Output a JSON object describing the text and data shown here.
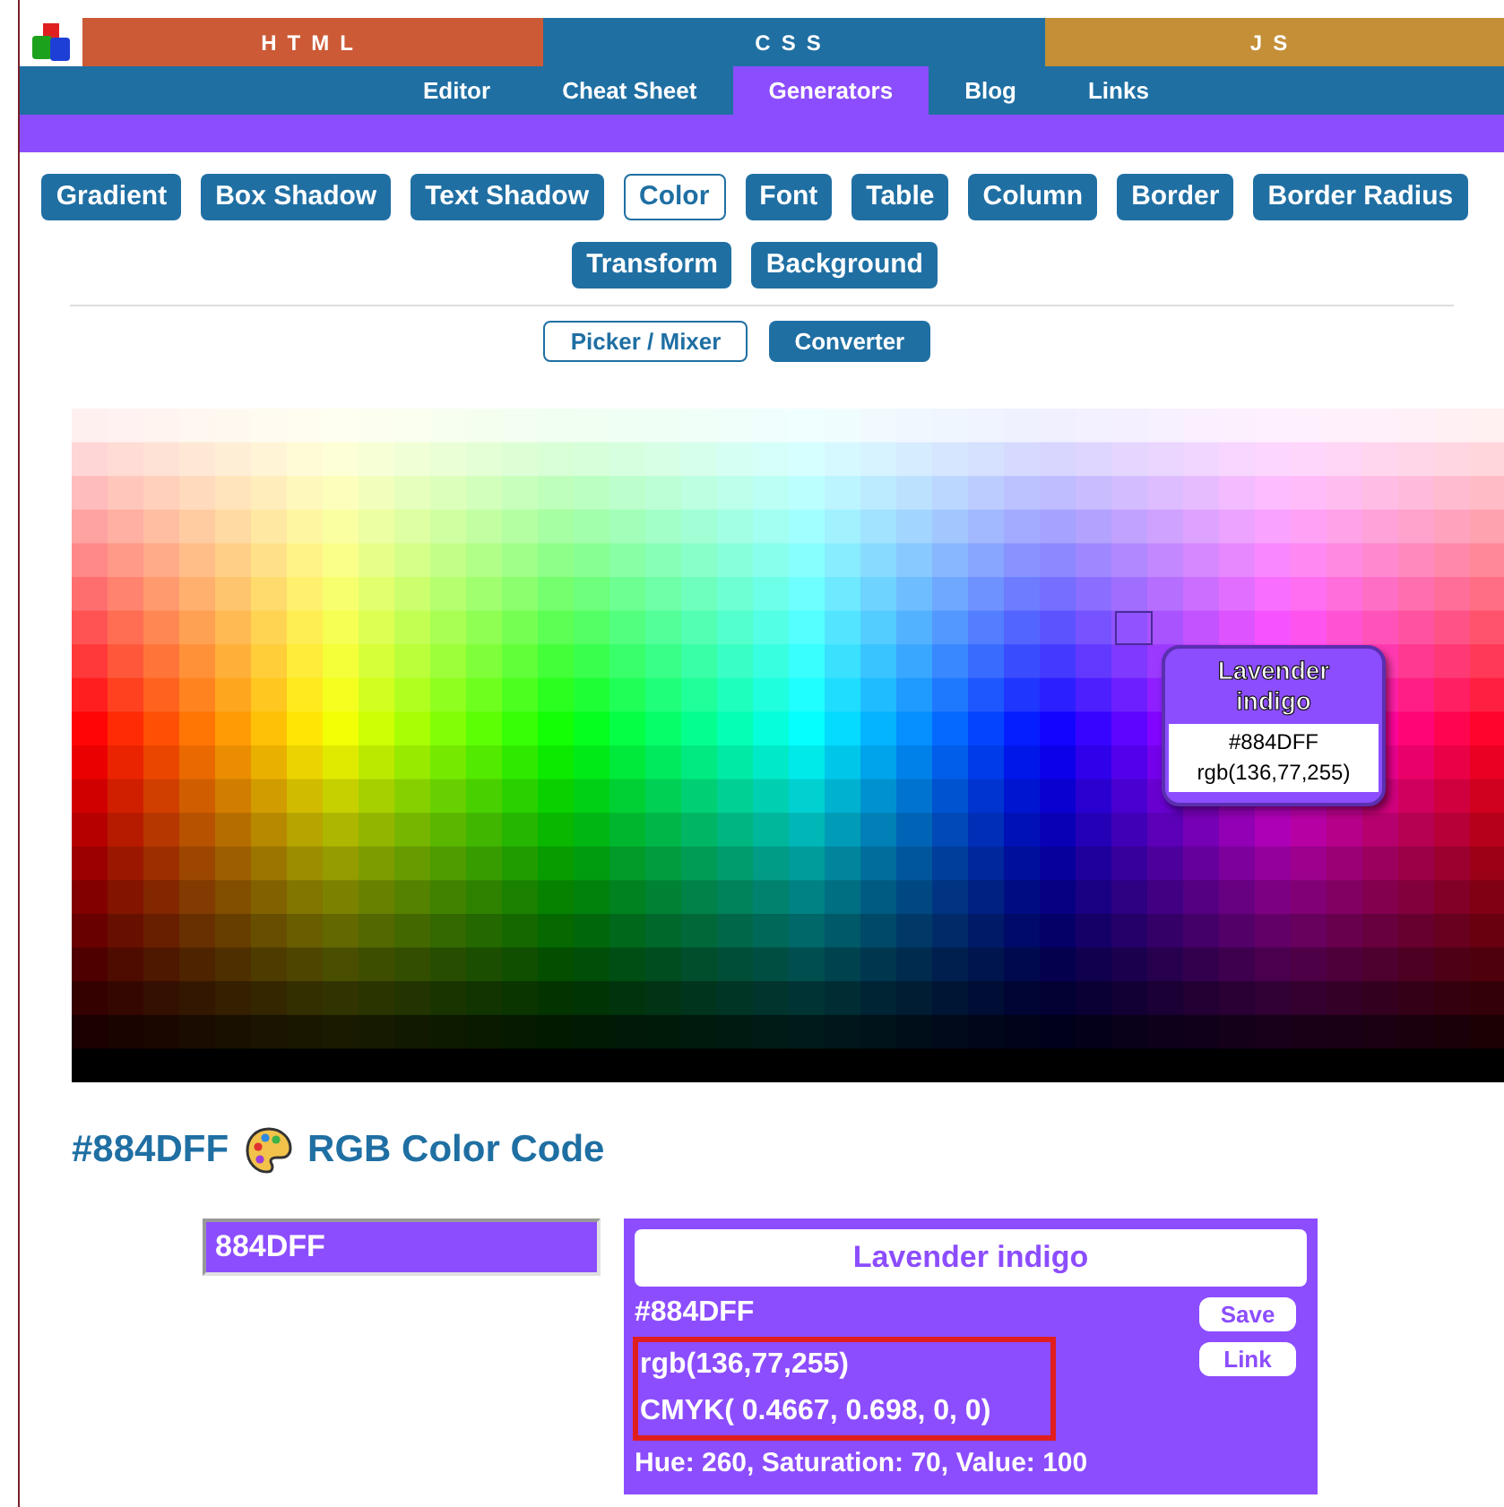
{
  "top_tabs": [
    {
      "label": "HTML",
      "color": "#cc5a36"
    },
    {
      "label": "CSS",
      "color": "#1f6fa3"
    },
    {
      "label": "JS",
      "color": "#c48f37"
    }
  ],
  "subnav": [
    {
      "label": "Editor",
      "selected": false
    },
    {
      "label": "Cheat Sheet",
      "selected": false
    },
    {
      "label": "Generators",
      "selected": true
    },
    {
      "label": "Blog",
      "selected": false
    },
    {
      "label": "Links",
      "selected": false
    }
  ],
  "generators": [
    {
      "label": "Gradient",
      "selected": false
    },
    {
      "label": "Box Shadow",
      "selected": false
    },
    {
      "label": "Text Shadow",
      "selected": false
    },
    {
      "label": "Color",
      "selected": true
    },
    {
      "label": "Font",
      "selected": false
    },
    {
      "label": "Table",
      "selected": false
    },
    {
      "label": "Column",
      "selected": false
    },
    {
      "label": "Border",
      "selected": false
    },
    {
      "label": "Border Radius",
      "selected": false
    },
    {
      "label": "Transform",
      "selected": false
    },
    {
      "label": "Background",
      "selected": false
    }
  ],
  "modes": [
    {
      "label": "Picker / Mixer",
      "selected": true
    },
    {
      "label": "Converter",
      "selected": false
    }
  ],
  "tooltip": {
    "name": "Lavender indigo",
    "hex": "#884DFF",
    "rgb": "rgb(136,77,255)"
  },
  "heading": {
    "code": "#884DFF",
    "title": "RGB Color Code"
  },
  "hex_input": {
    "value": "884DFF"
  },
  "info": {
    "name": "Lavender indigo",
    "hex": "#884DFF",
    "rgb": "rgb(136,77,255)",
    "cmyk": "CMYK( 0.4667, 0.698, 0, 0)",
    "hsv": "Hue: 260, Saturation: 70, Value: 100",
    "buttons": [
      "Save",
      "Link"
    ]
  }
}
